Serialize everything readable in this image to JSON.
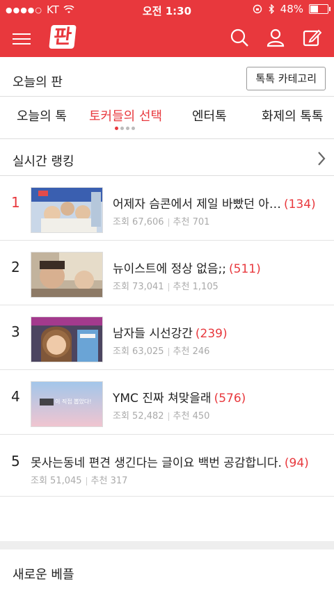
{
  "status": {
    "carrier": "KT",
    "time": "오전 1:30",
    "battery": "48%"
  },
  "nav": {
    "logo": "판",
    "icons": [
      "search-icon",
      "user-icon",
      "edit-icon"
    ]
  },
  "header": {
    "title": "오늘의 판",
    "category_button": "톡톡 카테고리"
  },
  "tabs": [
    {
      "label": "오늘의 톡",
      "active": false
    },
    {
      "label": "토커들의 선택",
      "active": true
    },
    {
      "label": "엔터톡",
      "active": false
    },
    {
      "label": "화제의 톡톡",
      "active": false
    }
  ],
  "ranking": {
    "title": "실시간 랭킹",
    "items": [
      {
        "rank": "1",
        "title": "어제자 슴콘에서 제일 바빴던 아…",
        "count": "(134)",
        "views": "조회 67,606",
        "recommend": "추천 701"
      },
      {
        "rank": "2",
        "title": "뉴이스트에 정상 없음;;",
        "count": "(511)",
        "views": "조회 73,041",
        "recommend": "추천 1,105"
      },
      {
        "rank": "3",
        "title": "남자들 시선강간",
        "count": "(239)",
        "views": "조회 63,025",
        "recommend": "추천 246"
      },
      {
        "rank": "4",
        "title": "YMC 진짜 쳐맞을래",
        "count": "(576)",
        "views": "조회 52,482",
        "recommend": "추천 450"
      },
      {
        "rank": "5",
        "title": "못사는동네 편견 생긴다는 글이요 백번 공감합니다.",
        "count": "(94)",
        "views": "조회 51,045",
        "recommend": "추천 317"
      }
    ]
  },
  "section2": {
    "title": "새로운 베플"
  },
  "thumb4_text": "이 직접 뽑았다!",
  "colors": {
    "accent": "#e8383d"
  }
}
